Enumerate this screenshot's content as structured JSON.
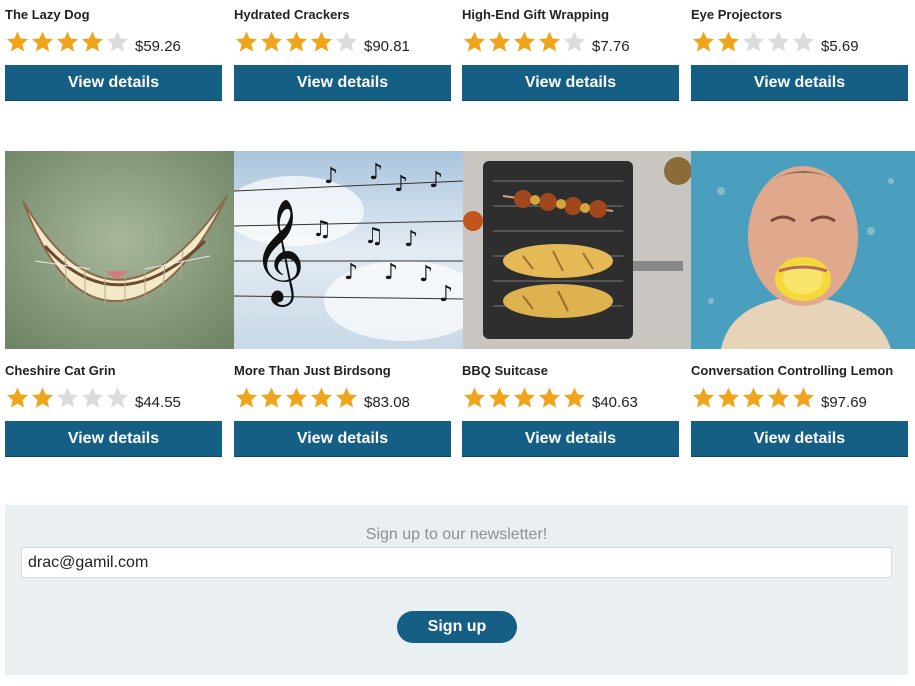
{
  "products_top": [
    {
      "name": "The Lazy Dog",
      "rating": 4,
      "price": "$59.26",
      "button": "View details"
    },
    {
      "name": "Hydrated Crackers",
      "rating": 4,
      "price": "$90.81",
      "button": "View details"
    },
    {
      "name": "High-End Gift Wrapping",
      "rating": 4,
      "price": "$7.76",
      "button": "View details"
    },
    {
      "name": "Eye Projectors",
      "rating": 2,
      "price": "$5.69",
      "button": "View details"
    }
  ],
  "products_bottom": [
    {
      "name": "Cheshire Cat Grin",
      "rating": 2,
      "price": "$44.55",
      "button": "View details",
      "image": "cheshire-cat-grin-image"
    },
    {
      "name": "More Than Just Birdsong",
      "rating": 5,
      "price": "$83.08",
      "button": "View details",
      "image": "birdsong-music-notes-image"
    },
    {
      "name": "BBQ Suitcase",
      "rating": 5,
      "price": "$40.63",
      "button": "View details",
      "image": "bbq-grill-image"
    },
    {
      "name": "Conversation Controlling Lemon",
      "rating": 5,
      "price": "$97.69",
      "button": "View details",
      "image": "man-biting-lemon-image"
    }
  ],
  "colors": {
    "star_filled": "#f0a41c",
    "star_empty": "#dcdcdc",
    "button": "#155f84",
    "newsletter_bg": "#eaeff2"
  },
  "newsletter": {
    "heading": "Sign up to our newsletter!",
    "email_value": "drac@gamil.com",
    "button": "Sign up"
  }
}
